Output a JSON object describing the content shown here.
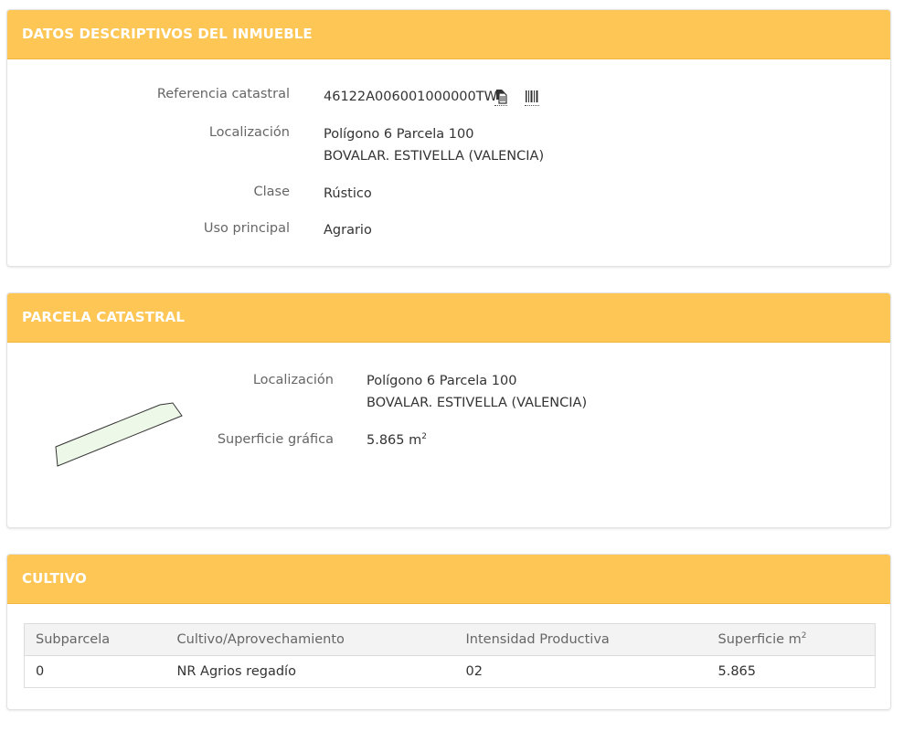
{
  "property_panel": {
    "title": "DATOS DESCRIPTIVOS DEL INMUEBLE",
    "rows": [
      {
        "label": "Referencia catastral",
        "value": "46122A006001000000TW"
      },
      {
        "label": "Localización",
        "value_lines": [
          "Polígono 6 Parcela 100",
          "BOVALAR. ESTIVELLA (VALENCIA)"
        ]
      },
      {
        "label": "Clase",
        "value": "Rústico"
      },
      {
        "label": "Uso principal",
        "value": "Agrario"
      }
    ],
    "icons": [
      "copy-icon",
      "barcode-icon"
    ]
  },
  "parcel_panel": {
    "title": "PARCELA CATASTRAL",
    "location_label": "Localización",
    "location_lines": [
      "Polígono 6 Parcela 100",
      "BOVALAR. ESTIVELLA (VALENCIA)"
    ],
    "surface_label": "Superficie gráfica",
    "surface_value": "5.865 m",
    "surface_unit_sup": "2",
    "shape_fill": "#eef8e8",
    "shape_stroke": "#333333"
  },
  "crop_panel": {
    "title": "CULTIVO",
    "columns": [
      "Subparcela",
      "Cultivo/Aprovechamiento",
      "Intensidad Productiva",
      "Superficie m"
    ],
    "column_sup": "2",
    "rows": [
      [
        "0",
        "NR Agrios regadío",
        "02",
        "5.865"
      ]
    ]
  },
  "colors": {
    "header_bg": "#fdc655",
    "header_text": "#ffffff",
    "label_text": "#666666",
    "value_text": "#333333"
  }
}
